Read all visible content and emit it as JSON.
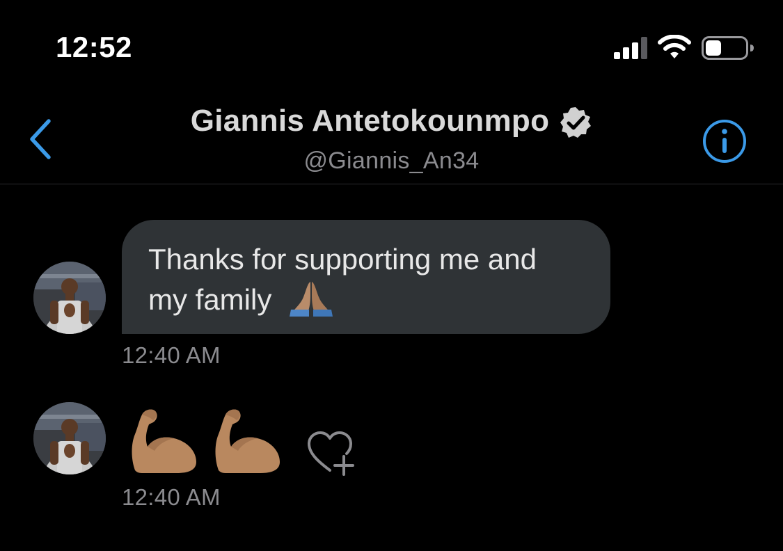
{
  "status_bar": {
    "time": "12:52",
    "signal_icon": "cellular-signal-icon",
    "wifi_icon": "wifi-icon",
    "battery_icon": "battery-icon",
    "battery_level": 0.4
  },
  "header": {
    "back_icon": "chevron-left-icon",
    "contact_name": "Giannis Antetokounmpo",
    "verified_icon": "verified-badge-icon",
    "handle": "@Giannis_An34",
    "info_icon": "info-circle-icon",
    "accent_color": "#3b9ae8"
  },
  "messages": [
    {
      "text_line1": "Thanks for supporting me and",
      "text_line2": "my family",
      "emoji": "folded-hands-emoji",
      "timestamp": "12:40 AM"
    },
    {
      "emojis": [
        "flexed-biceps-emoji",
        "flexed-biceps-emoji"
      ],
      "react_icon": "heart-plus-icon",
      "timestamp": "12:40 AM"
    }
  ],
  "colors": {
    "background": "#000000",
    "bubble": "#2f3336",
    "secondary_text": "#8b8b8f",
    "accent": "#3b9ae8"
  }
}
